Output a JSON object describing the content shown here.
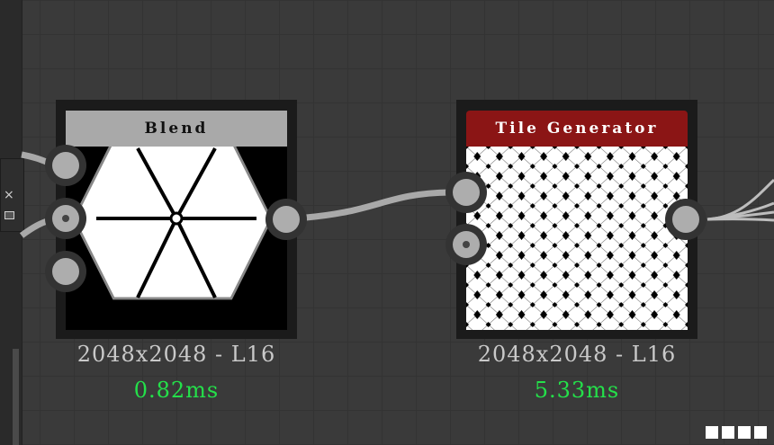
{
  "canvas": {
    "background": "#3a3a3a",
    "grid_color": "#333333"
  },
  "panel": {
    "close_icon": "×"
  },
  "nodes": [
    {
      "title": "Blend",
      "title_bg": "#a9a9a9",
      "title_color": "#111111",
      "resolution": "2048x2048 - L16",
      "timing": "0.82ms",
      "thumbnail": "hexagon-blend-preview"
    },
    {
      "title": "Tile Generator",
      "title_bg": "#8b1515",
      "title_color": "#ffffff",
      "resolution": "2048x2048 - L16",
      "timing": "5.33ms",
      "thumbnail": "tile-pattern-preview"
    }
  ],
  "timing_color": "#24e04a"
}
